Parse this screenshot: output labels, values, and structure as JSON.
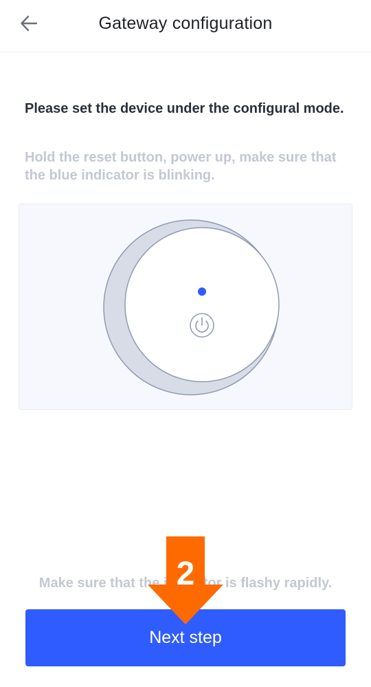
{
  "header": {
    "title": "Gateway configuration",
    "back_icon": "arrow-left-icon"
  },
  "instructions": {
    "heading": "Please set the device under the configural mode.",
    "subtext": "Hold the reset button, power up, make sure that the blue indicator is blinking."
  },
  "illustration": {
    "indicator_color": "#2f5cff",
    "power_icon": "power-icon"
  },
  "hint": {
    "text": "Make sure that the indicator is flashy rapidly."
  },
  "footer": {
    "next_label": "Next step"
  },
  "annotation": {
    "number": "2",
    "color": "#ff6a00"
  },
  "colors": {
    "accent": "#2f5cff",
    "annotation": "#ff6a00"
  }
}
